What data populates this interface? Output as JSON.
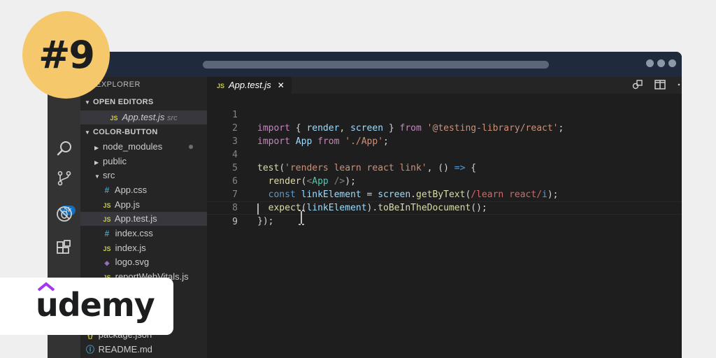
{
  "episode": {
    "label": "#9"
  },
  "brand": {
    "name": "udemy",
    "accent": "#a435f0"
  },
  "sidebar": {
    "title": "EXPLORER",
    "open_editors_label": "OPEN EDITORS",
    "open_editor": {
      "name": "App.test.js",
      "path": "src"
    },
    "project_label": "COLOR-BUTTON",
    "items": [
      {
        "name": "node_modules",
        "kind": "folder"
      },
      {
        "name": "public",
        "kind": "folder"
      },
      {
        "name": "src",
        "kind": "folder-open"
      },
      {
        "name": "App.css",
        "kind": "css"
      },
      {
        "name": "App.js",
        "kind": "js"
      },
      {
        "name": "App.test.js",
        "kind": "js",
        "selected": true
      },
      {
        "name": "index.css",
        "kind": "css"
      },
      {
        "name": "index.js",
        "kind": "js"
      },
      {
        "name": "logo.svg",
        "kind": "svg"
      },
      {
        "name": "reportWebVitals.js",
        "kind": "js"
      },
      {
        "name": "s",
        "kind": "js"
      },
      {
        "name": "son",
        "kind": "json"
      },
      {
        "name": "package.json",
        "kind": "json"
      },
      {
        "name": "README.md",
        "kind": "info"
      }
    ],
    "badge_count": "5k"
  },
  "tabs": [
    {
      "label": "App.test.js",
      "close": "✕"
    }
  ],
  "editor": {
    "line_numbers": [
      "1",
      "2",
      "3",
      "4",
      "5",
      "6",
      "7",
      "8",
      "9"
    ],
    "lines": [
      "import { render, screen } from '@testing-library/react';",
      "import App from './App';",
      "",
      "test('renders learn react link', () => {",
      "  render(<App />);",
      "  const linkElement = screen.getByText(/learn react/i);",
      "  expect(linkElement).toBeInTheDocument();",
      "});",
      ""
    ],
    "current_line": 9
  },
  "icons": {
    "activity": [
      "files-icon",
      "search-icon",
      "source-control-icon",
      "debug-icon",
      "extensions-icon"
    ],
    "editor_actions": [
      "split-compare-icon",
      "split-editor-icon"
    ]
  }
}
